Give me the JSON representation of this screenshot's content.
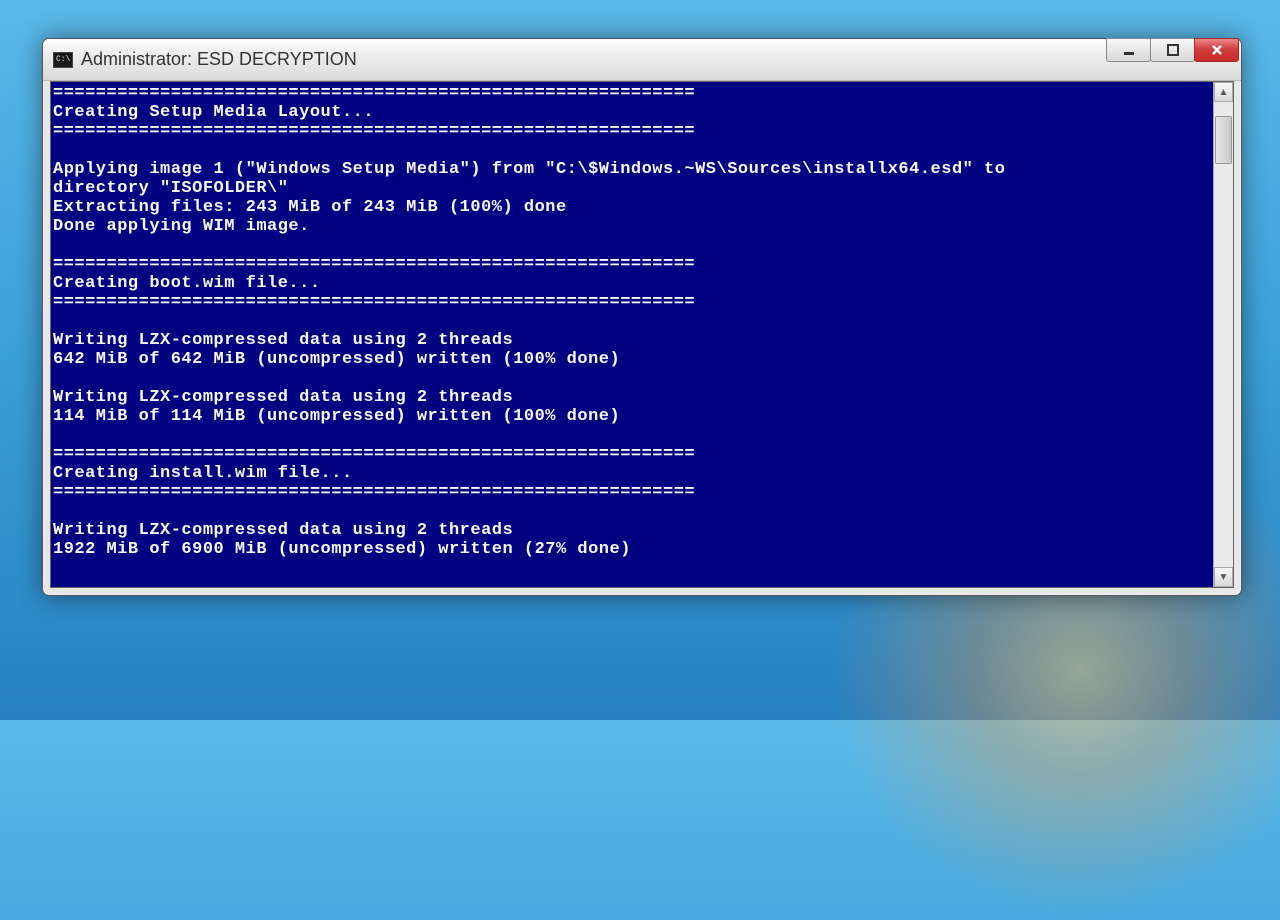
{
  "window": {
    "title": "Administrator:  ESD DECRYPTION",
    "icon_text": "C:\\"
  },
  "console": {
    "lines": [
      "============================================================",
      "Creating Setup Media Layout...",
      "============================================================",
      "",
      "Applying image 1 (\"Windows Setup Media\") from \"C:\\$Windows.~WS\\Sources\\installx64.esd\" to",
      "directory \"ISOFOLDER\\\"",
      "Extracting files: 243 MiB of 243 MiB (100%) done",
      "Done applying WIM image.",
      "",
      "============================================================",
      "Creating boot.wim file...",
      "============================================================",
      "",
      "Writing LZX-compressed data using 2 threads",
      "642 MiB of 642 MiB (uncompressed) written (100% done)",
      "",
      "Writing LZX-compressed data using 2 threads",
      "114 MiB of 114 MiB (uncompressed) written (100% done)",
      "",
      "============================================================",
      "Creating install.wim file...",
      "============================================================",
      "",
      "Writing LZX-compressed data using 2 threads",
      "1922 MiB of 6900 MiB (uncompressed) written (27% done)"
    ]
  }
}
